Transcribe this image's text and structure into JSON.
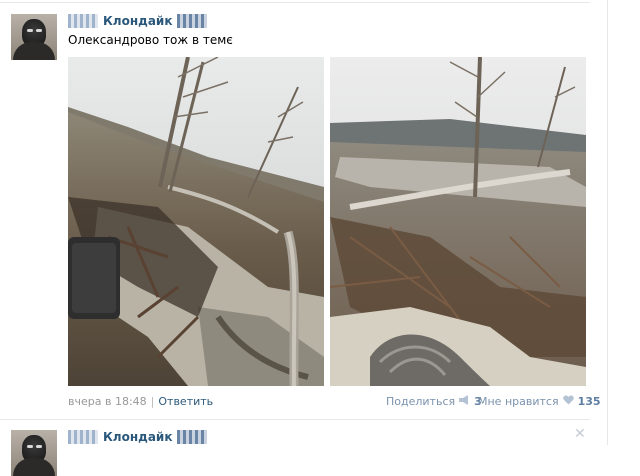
{
  "post": {
    "author": "Клондайк",
    "text": "Олександрово тож в темє",
    "timestamp": "вчера в 18:48",
    "reply_label": "Ответить",
    "share_label": "Поделиться",
    "share_count": "3",
    "like_label": "Мне нравится",
    "like_count": "135"
  },
  "next_post": {
    "author": "Клондайк"
  },
  "colors": {
    "link": "#2b587a",
    "meta": "#999999",
    "action": "#7b93ad"
  },
  "icons": {
    "share": "megaphone-icon",
    "like": "heart-icon",
    "close": "close-icon"
  }
}
